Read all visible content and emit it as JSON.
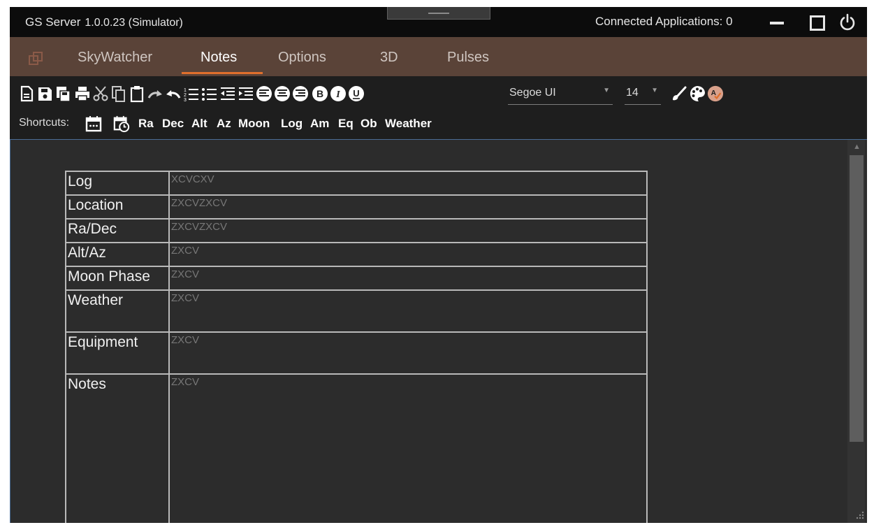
{
  "titlebar": {
    "app_name": "GS Server",
    "version": "1.0.0.23  (Simulator)",
    "connected_label": "Connected Applications:",
    "connected_count": "0"
  },
  "tabs": [
    {
      "label": "SkyWatcher",
      "active": false
    },
    {
      "label": "Notes",
      "active": true
    },
    {
      "label": "Options",
      "active": false
    },
    {
      "label": "3D",
      "active": false
    },
    {
      "label": "Pulses",
      "active": false
    }
  ],
  "toolbar": {
    "icons": [
      "new-document-icon",
      "save-icon",
      "save-as-icon",
      "print-icon",
      "cut-icon",
      "copy-icon",
      "paste-icon",
      "redo-icon",
      "undo-icon",
      "numbered-list-icon",
      "bulleted-list-icon",
      "decrease-indent-icon",
      "increase-indent-icon",
      "align-left-icon",
      "align-center-icon",
      "align-right-icon",
      "bold-icon",
      "italic-icon",
      "underline-icon"
    ],
    "font_family": "Segoe UI",
    "font_size": "14",
    "trailing_icons": [
      "brush-icon",
      "palette-icon",
      "spellcheck-icon"
    ]
  },
  "shortcuts": {
    "label": "Shortcuts:",
    "items": [
      "Ra",
      "Dec",
      "Alt",
      "Az",
      "Moon",
      "Log",
      "Am",
      "Eq",
      "Ob",
      "Weather"
    ]
  },
  "notes_table": [
    {
      "key": "Log",
      "value": "XCVCXV"
    },
    {
      "key": "Location",
      "value": "ZXCVZXCV"
    },
    {
      "key": "Ra/Dec",
      "value": "ZXCVZXCV"
    },
    {
      "key": "Alt/Az",
      "value": "ZXCV"
    },
    {
      "key": "Moon Phase",
      "value": "ZXCV"
    },
    {
      "key": "Weather",
      "value": "ZXCV"
    },
    {
      "key": "Equipment",
      "value": "ZXCV"
    },
    {
      "key": "Notes",
      "value": "ZXCV"
    }
  ],
  "colors": {
    "titlebar": "#0c0c0c",
    "menubar": "#5a4338",
    "active_tab_underline": "#e06f2c",
    "toolbar": "#1e1e1e",
    "editor": "#2c2c2c",
    "spellcheck_accent": "#e06f2c"
  }
}
